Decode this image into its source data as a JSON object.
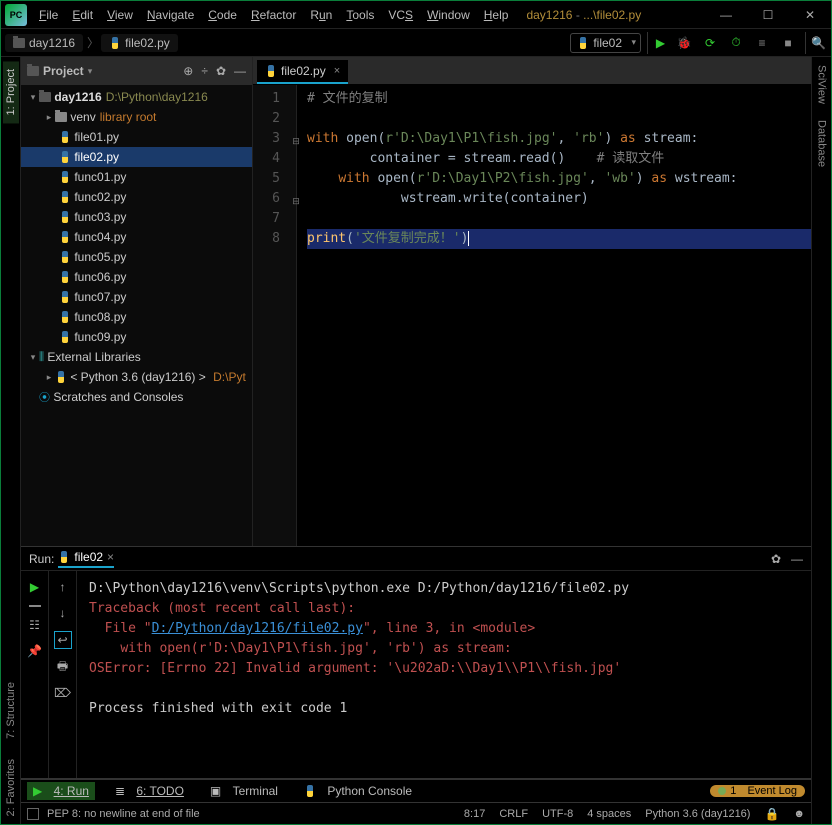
{
  "title": {
    "project": "day1216",
    "sep": " - ",
    "path": "...\\file02.py"
  },
  "menu": [
    "File",
    "Edit",
    "View",
    "Navigate",
    "Code",
    "Refactor",
    "Run",
    "Tools",
    "VCS",
    "Window",
    "Help"
  ],
  "crumbs": {
    "project": "day1216",
    "file": "file02.py"
  },
  "runcfg": "file02",
  "left_tabs": {
    "project": "1: Project",
    "structure": "7: Structure",
    "favorites": "2: Favorites"
  },
  "right_tabs": {
    "sciview": "SciView",
    "database": "Database"
  },
  "projhdr": "Project",
  "tree": {
    "root": {
      "name": "day1216",
      "path": "D:\\Python\\day1216"
    },
    "venv": {
      "name": "venv",
      "tag": "library root"
    },
    "files": [
      "file01.py",
      "file02.py",
      "func01.py",
      "func02.py",
      "func03.py",
      "func04.py",
      "func05.py",
      "func06.py",
      "func07.py",
      "func08.py",
      "func09.py"
    ],
    "ext": "External Libraries",
    "sdk": {
      "pre": "< Python 3.6 (day1216) >",
      "path": "D:\\Pyt"
    },
    "scratch": "Scratches and Consoles"
  },
  "selected_file_index": 1,
  "edtab": "file02.py",
  "gutter": [
    "1",
    "2",
    "3",
    "4",
    "5",
    "6",
    "7",
    "8"
  ],
  "code": {
    "l1_cm": "# 文件的复制",
    "l3_with": "with",
    "l3_open": "open",
    "l3_s1": "r'D:\\Day1\\P1\\fish.jpg'",
    "l3_c": ",",
    "l3_s2": "'rb'",
    "l3_p": ")",
    "l3_as": "as",
    "l3_v": "stream:",
    "l4": "        container = stream.read()    ",
    "l4_cm": "# 读取文件",
    "l5_with": "with",
    "l5_open": "open",
    "l5_s1": "r'D:\\Day1\\P2\\fish.jpg'",
    "l5_c": ",",
    "l5_s2": "'wb'",
    "l5_p": ")",
    "l5_as": "as",
    "l5_v": "wstream:",
    "l6": "            wstream.write(container)",
    "l8_print": "print",
    "l8_s": "'文件复制完成！'"
  },
  "run": {
    "hdr": "Run:",
    "cfg": "file02",
    "lines": {
      "cmd": "D:\\Python\\day1216\\venv\\Scripts\\python.exe D:/Python/day1216/file02.py",
      "tb": "Traceback (most recent call last):",
      "f_pre": "  File \"",
      "f_lnk": "D:/Python/day1216/file02.py",
      "f_post": "\", line 3, in <module>",
      "src": "    with open(r'D:\\Day1\\P1\\fish.jpg', 'rb') as stream:",
      "err": "OSError: [Errno 22] Invalid argument: '\\u202aD:\\\\Day1\\\\P1\\\\fish.jpg'",
      "exit": "Process finished with exit code 1"
    }
  },
  "bottom": {
    "run": "4: Run",
    "todo": "6: TODO",
    "terminal": "Terminal",
    "pyconsole": "Python Console",
    "event": "Event Log",
    "eventn": "1"
  },
  "status": {
    "pep": "PEP 8: no newline at end of file",
    "pos": "8:17",
    "le": "CRLF",
    "enc": "UTF-8",
    "ind": "4 spaces",
    "sdk": "Python 3.6 (day1216)"
  }
}
